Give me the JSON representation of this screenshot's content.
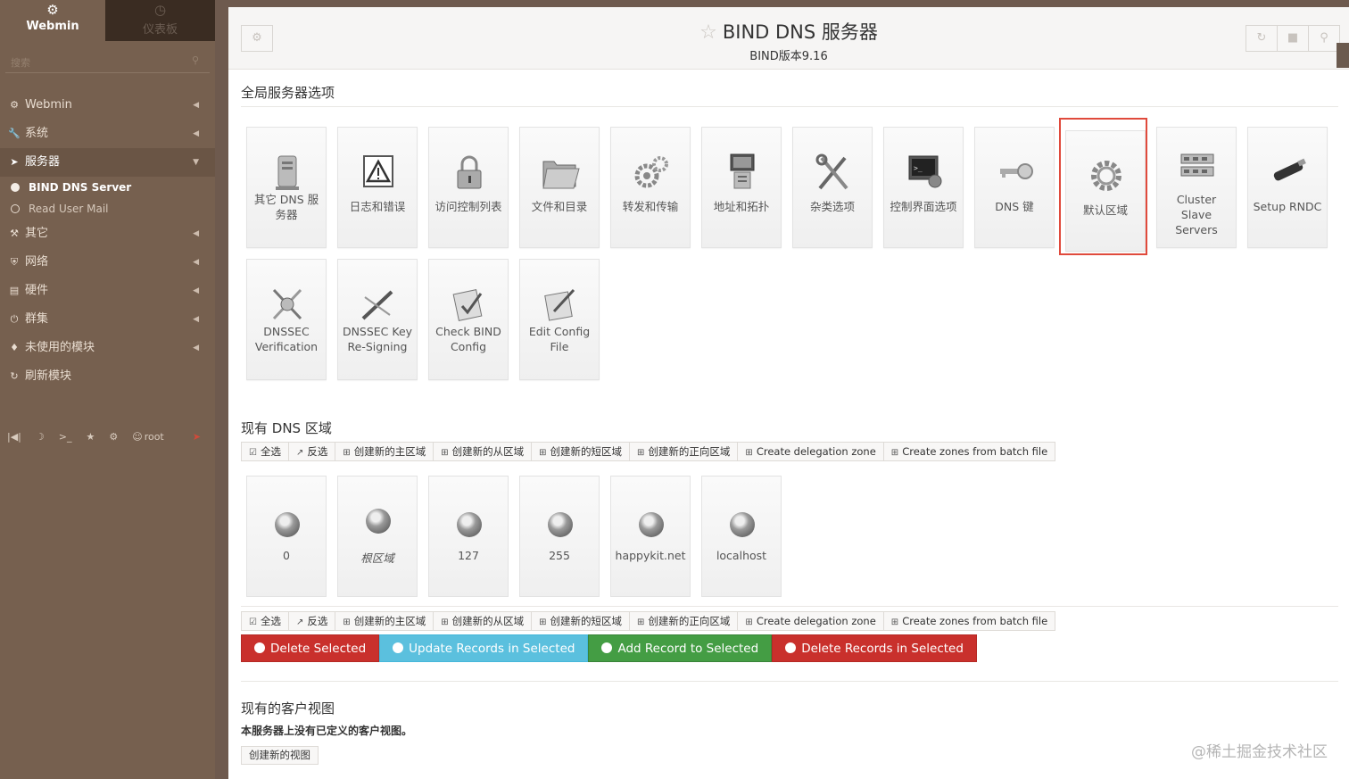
{
  "sidebar": {
    "tabs": [
      {
        "label": "Webmin",
        "icon": "webmin-logo-icon"
      },
      {
        "label": "仪表板",
        "icon": "dashboard-icon"
      }
    ],
    "search_placeholder": "搜索",
    "menu": [
      {
        "label": "Webmin",
        "icon": "gear-icon"
      },
      {
        "label": "系统",
        "icon": "wrench-icon"
      },
      {
        "label": "服务器",
        "icon": "rocket-icon"
      },
      {
        "label": "其它",
        "icon": "tools-icon"
      },
      {
        "label": "网络",
        "icon": "shield-icon"
      },
      {
        "label": "硬件",
        "icon": "drive-icon"
      },
      {
        "label": "群集",
        "icon": "power-icon"
      },
      {
        "label": "未使用的模块",
        "icon": "puzzle-icon"
      },
      {
        "label": "刷新模块",
        "icon": "refresh-icon"
      }
    ],
    "submenu": [
      {
        "label": "BIND DNS Server"
      },
      {
        "label": "Read User Mail"
      }
    ],
    "bottom": {
      "user": "root"
    }
  },
  "header": {
    "title": "BIND DNS 服务器",
    "subtitle": "BIND版本9.16"
  },
  "global_section": {
    "title": "全局服务器选项",
    "icons": [
      {
        "label": "其它 DNS 服务器",
        "icon": "server-icon"
      },
      {
        "label": "日志和错误",
        "icon": "warning-icon"
      },
      {
        "label": "访问控制列表",
        "icon": "lock-icon"
      },
      {
        "label": "文件和目录",
        "icon": "folder-icon"
      },
      {
        "label": "转发和传输",
        "icon": "gears-icon"
      },
      {
        "label": "地址和拓扑",
        "icon": "computer-icon"
      },
      {
        "label": "杂类选项",
        "icon": "tools-icon"
      },
      {
        "label": "控制界面选项",
        "icon": "console-icon"
      },
      {
        "label": "DNS 键",
        "icon": "key-icon"
      },
      {
        "label": "默认区域",
        "icon": "gear-icon"
      },
      {
        "label": "Cluster Slave Servers",
        "icon": "network-icon"
      },
      {
        "label": "Setup RNDC",
        "icon": "usb-key-icon"
      },
      {
        "label": "DNSSEC Verification",
        "icon": "dnssec-icon"
      },
      {
        "label": "DNSSEC Key Re-Signing",
        "icon": "pen-icon"
      },
      {
        "label": "Check BIND Config",
        "icon": "check-icon"
      },
      {
        "label": "Edit Config File",
        "icon": "edit-icon"
      }
    ]
  },
  "zones_section": {
    "title": "现有 DNS 区域",
    "toolbar": [
      {
        "label": "全选",
        "icon": "check-square-icon"
      },
      {
        "label": "反选",
        "icon": "share-icon"
      },
      {
        "label": "创建新的主区域",
        "icon": "plus-square-icon"
      },
      {
        "label": "创建新的从区域",
        "icon": "plus-square-icon"
      },
      {
        "label": "创建新的短区域",
        "icon": "plus-square-icon"
      },
      {
        "label": "创建新的正向区域",
        "icon": "plus-square-icon"
      },
      {
        "label": "Create delegation zone",
        "icon": "plus-square-icon"
      },
      {
        "label": "Create zones from batch file",
        "icon": "plus-square-icon"
      }
    ],
    "zones": [
      {
        "label": "0"
      },
      {
        "label": "根区域"
      },
      {
        "label": "127"
      },
      {
        "label": "255"
      },
      {
        "label": "happykit.net"
      },
      {
        "label": "localhost"
      }
    ],
    "actions": [
      {
        "label": "Delete Selected",
        "color": "#c9302c"
      },
      {
        "label": "Update Records in Selected",
        "color": "#5bc0de"
      },
      {
        "label": "Add Record to Selected",
        "color": "#449d44"
      },
      {
        "label": "Delete Records in Selected",
        "color": "#c9302c"
      }
    ]
  },
  "views_section": {
    "title": "现有的客户视图",
    "note": "本服务器上没有已定义的客户视图。",
    "create_button": "创建新的视图"
  },
  "watermark": "@稀土掘金技术社区"
}
